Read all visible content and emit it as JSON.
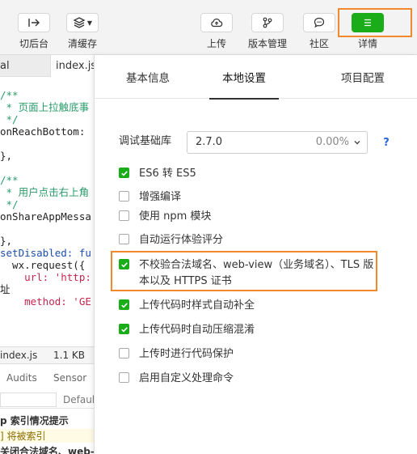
{
  "toolbar": {
    "left_items": [
      {
        "label": "切后台",
        "icon": "switch-background-icon"
      },
      {
        "label": "清缓存",
        "icon": "layers-clear-cache-icon"
      }
    ],
    "right_items": [
      {
        "label": "上传",
        "icon": "cloud-upload-icon"
      },
      {
        "label": "版本管理",
        "icon": "version-branch-icon"
      },
      {
        "label": "社区",
        "icon": "chat-bubble-icon"
      },
      {
        "label": "详情",
        "icon": "menu-lines-icon"
      }
    ]
  },
  "editor": {
    "tabs": [
      "al",
      "index.js"
    ],
    "code_lines": [
      {
        "text": "/**",
        "kind": "comment"
      },
      {
        "text": " * 页面上拉触底事",
        "kind": "comment"
      },
      {
        "text": " */",
        "kind": "comment"
      },
      {
        "text": "onReachBottom:",
        "kind": "plain"
      },
      {
        "text": "",
        "kind": "plain"
      },
      {
        "text": "},",
        "kind": "plain"
      },
      {
        "text": "",
        "kind": "plain"
      },
      {
        "text": "/**",
        "kind": "comment"
      },
      {
        "text": " * 用户点击右上角",
        "kind": "comment"
      },
      {
        "text": " */",
        "kind": "comment"
      },
      {
        "text": "onShareAppMessa",
        "kind": "plain"
      },
      {
        "text": "",
        "kind": "plain"
      },
      {
        "text": "},",
        "kind": "plain"
      },
      {
        "text": "setDisabled: fu",
        "kind": "fn"
      },
      {
        "text": "  wx.request({",
        "kind": "plain"
      },
      {
        "text": "    url: 'http:",
        "kind": "str"
      },
      {
        "text": "址",
        "kind": "plain"
      },
      {
        "text": "    method: 'GE",
        "kind": "str"
      }
    ],
    "file_bar": {
      "name": "index.js",
      "size": "1.1 KB"
    },
    "debug_tabs": [
      "Audits",
      "Sensor"
    ],
    "filter_default": "Default",
    "log_lines": [
      {
        "text": "p 索引情况提示",
        "color": "#222",
        "bold": true
      },
      {
        "text": "] 将被索引",
        "color": "#8a6d00",
        "bold": false
      },
      {
        "text": "关闭合法域名、web-v",
        "color": "#222",
        "bold": true
      }
    ]
  },
  "panel": {
    "tabs": [
      "基本信息",
      "本地设置",
      "项目配置"
    ],
    "active_tab": 1,
    "base_lib": {
      "label": "调试基础库",
      "value": "2.7.0",
      "percent": "0.00%",
      "help": "?"
    },
    "options": [
      {
        "label": "ES6 转 ES5",
        "checked": true
      },
      {
        "label": "增强编译",
        "checked": false
      },
      {
        "label": "使用 npm 模块",
        "checked": false
      },
      {
        "label": "自动运行体验评分",
        "checked": false
      },
      {
        "label": "不校验合法域名、web-view（业务域名）、TLS 版本以及 HTTPS 证书",
        "checked": true
      },
      {
        "label": "上传代码时样式自动补全",
        "checked": true
      },
      {
        "label": "上传代码时自动压缩混淆",
        "checked": true
      },
      {
        "label": "上传时进行代码保护",
        "checked": false
      },
      {
        "label": "启用自定义处理命令",
        "checked": false
      }
    ]
  },
  "colors": {
    "accent_green": "#1aad19",
    "highlight_orange": "#f08a2c",
    "link_blue": "#2b66d9"
  }
}
